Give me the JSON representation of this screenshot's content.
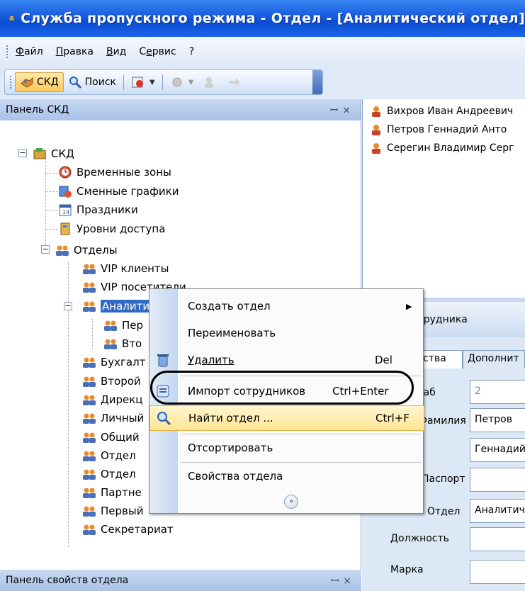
{
  "window": {
    "title": "Служба пропускного режима - Отдел - [Аналитический отдел]"
  },
  "menubar": {
    "items": [
      {
        "accel": "Ф",
        "rest": "айл"
      },
      {
        "accel": "П",
        "rest": "равка"
      },
      {
        "accel": "В",
        "rest": "ид"
      },
      {
        "pre": "С",
        "accel": "е",
        "rest": "рвис"
      },
      {
        "accel": "",
        "rest": "?"
      }
    ]
  },
  "toolbar": {
    "skd_label": "СКД",
    "search_label": "Поиск"
  },
  "left_panel": {
    "title": "Панель СКД",
    "pin": "⊅",
    "close": "×"
  },
  "tree": {
    "root": "СКД",
    "time_zones": "Временные зоны",
    "shift_schedules": "Сменные графики",
    "holidays": "Праздники",
    "access_levels": "Уровни доступа",
    "departments": "Отделы",
    "dept_items": [
      "VIP клиенты",
      "VIP посетители",
      "Аналитический отдел",
      "Пер",
      "Вто",
      "Бухгалт",
      "Второй",
      "Дирекц",
      "Личный",
      "Общий",
      "Отдел",
      "Отдел",
      "Партне",
      "Первый",
      "Секретариат"
    ]
  },
  "bottom_panel": {
    "title": "Панель свойств отдела"
  },
  "employees": [
    "Вихров Иван Андреевич",
    "Петров Геннадий Анто",
    "Серегин Владимир Серг"
  ],
  "employee_panel": {
    "header": "отрудника",
    "tab_props": "йства",
    "tab_extra": "Дополнит",
    "labels": {
      "number": "Таб",
      "surname": "Фамилия",
      "name": "",
      "passport": "Паспорт",
      "department": "Отдел",
      "position": "Должность",
      "mark": "Марка"
    },
    "values": {
      "number": "2",
      "surname": "Петров",
      "name": "Геннадий",
      "department": "Аналитический"
    }
  },
  "context_menu": {
    "items": [
      {
        "label": "Создать отдел",
        "shortcut": ""
      },
      {
        "label": "Переименовать",
        "shortcut": ""
      },
      {
        "label": "Удалить",
        "shortcut": "Del"
      },
      {
        "label": "Импорт сотрудников",
        "shortcut": "Ctrl+Enter"
      },
      {
        "label": "Найти отдел ...",
        "shortcut": "Ctrl+F"
      },
      {
        "label": "Отсортировать",
        "shortcut": ""
      },
      {
        "label": "Свойства отдела",
        "shortcut": ""
      }
    ],
    "more": "»"
  }
}
